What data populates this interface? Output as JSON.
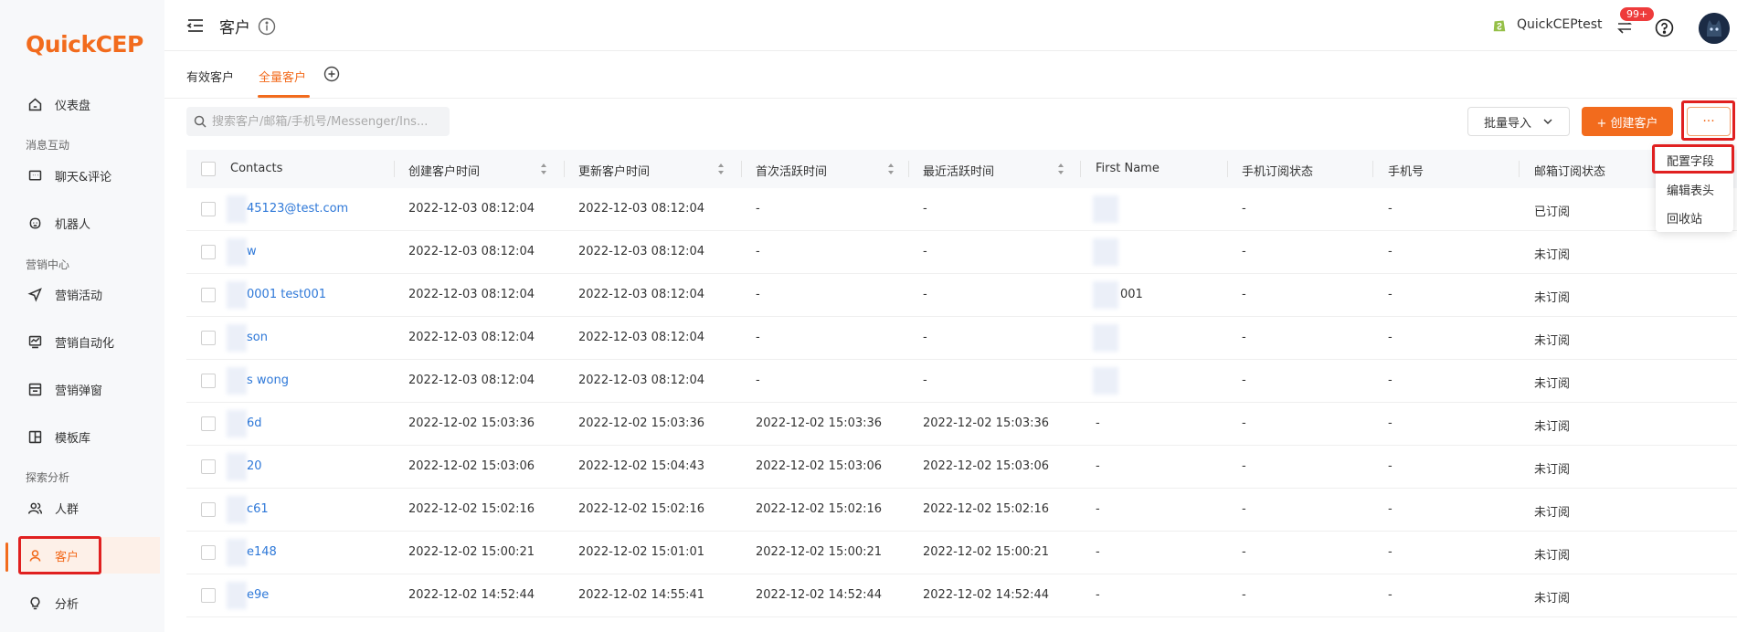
{
  "app": {
    "logo": {
      "q": "Q",
      "rest": "uick",
      "cep": "CEP"
    }
  },
  "colors": {
    "accent": "#f26b1d",
    "link": "#2e78d8",
    "alert": "#e02020"
  },
  "sidebar": {
    "items": [
      {
        "label": "仪表盘",
        "icon": "home-icon"
      },
      {
        "section": "消息互动"
      },
      {
        "label": "聊天&评论",
        "icon": "chat-icon"
      },
      {
        "label": "机器人",
        "icon": "robot-icon"
      },
      {
        "section": "营销中心"
      },
      {
        "label": "营销活动",
        "icon": "send-icon"
      },
      {
        "label": "营销自动化",
        "icon": "automation-icon"
      },
      {
        "label": "营销弹窗",
        "icon": "popup-icon"
      },
      {
        "label": "模板库",
        "icon": "template-icon"
      },
      {
        "section": "探索分析"
      },
      {
        "label": "人群",
        "icon": "people-icon"
      },
      {
        "label": "客户",
        "icon": "user-icon",
        "active": true
      },
      {
        "label": "分析",
        "icon": "bulb-icon"
      }
    ],
    "labels": {
      "dashboard": "仪表盘",
      "section_message": "消息互动",
      "chat": "聊天&评论",
      "robot": "机器人",
      "section_marketing": "营销中心",
      "campaign": "营销活动",
      "automation": "营销自动化",
      "popup": "营销弹窗",
      "template": "模板库",
      "section_explore": "探索分析",
      "audience": "人群",
      "customers": "客户",
      "analysis": "分析"
    }
  },
  "header": {
    "title": "客户",
    "shop_name": "QuickCEPtest",
    "notification_badge": "99+"
  },
  "tabs": {
    "valid": "有效客户",
    "all": "全量客户"
  },
  "toolbar": {
    "search_placeholder": "搜索客户/邮箱/手机号/Messenger/Ins...",
    "import_label": "批量导入",
    "create_label": "+ 创建客户",
    "more_label": "···"
  },
  "dropdown": {
    "items": [
      "配置字段",
      "编辑表头",
      "回收站"
    ]
  },
  "table": {
    "columns": [
      "Contacts",
      "创建客户时间",
      "更新客户时间",
      "首次活跃时间",
      "最近活跃时间",
      "First Name",
      "手机订阅状态",
      "手机号",
      "邮箱订阅状态"
    ],
    "rows": [
      {
        "contact": "45123@test.com",
        "created": "2022-12-03 08:12:04",
        "updated": "2022-12-03 08:12:04",
        "first_active": "-",
        "last_active": "-",
        "first_name": "",
        "sms_status": "-",
        "phone": "-",
        "email_status": "已订阅"
      },
      {
        "contact": "w",
        "created": "2022-12-03 08:12:04",
        "updated": "2022-12-03 08:12:04",
        "first_active": "-",
        "last_active": "-",
        "first_name": "",
        "sms_status": "-",
        "phone": "-",
        "email_status": "未订阅"
      },
      {
        "contact": "0001 test001",
        "created": "2022-12-03 08:12:04",
        "updated": "2022-12-03 08:12:04",
        "first_active": "-",
        "last_active": "-",
        "first_name": "001",
        "sms_status": "-",
        "phone": "-",
        "email_status": "未订阅"
      },
      {
        "contact": "son",
        "created": "2022-12-03 08:12:04",
        "updated": "2022-12-03 08:12:04",
        "first_active": "-",
        "last_active": "-",
        "first_name": "",
        "sms_status": "-",
        "phone": "-",
        "email_status": "未订阅"
      },
      {
        "contact": "s wong",
        "created": "2022-12-03 08:12:04",
        "updated": "2022-12-03 08:12:04",
        "first_active": "-",
        "last_active": "-",
        "first_name": "",
        "sms_status": "-",
        "phone": "-",
        "email_status": "未订阅"
      },
      {
        "contact": "6d",
        "created": "2022-12-02 15:03:36",
        "updated": "2022-12-02 15:03:36",
        "first_active": "2022-12-02 15:03:36",
        "last_active": "2022-12-02 15:03:36",
        "first_name": "-",
        "sms_status": "-",
        "phone": "-",
        "email_status": "未订阅"
      },
      {
        "contact": "20",
        "created": "2022-12-02 15:03:06",
        "updated": "2022-12-02 15:04:43",
        "first_active": "2022-12-02 15:03:06",
        "last_active": "2022-12-02 15:03:06",
        "first_name": "-",
        "sms_status": "-",
        "phone": "-",
        "email_status": "未订阅"
      },
      {
        "contact": "c61",
        "created": "2022-12-02 15:02:16",
        "updated": "2022-12-02 15:02:16",
        "first_active": "2022-12-02 15:02:16",
        "last_active": "2022-12-02 15:02:16",
        "first_name": "-",
        "sms_status": "-",
        "phone": "-",
        "email_status": "未订阅"
      },
      {
        "contact": "e148",
        "created": "2022-12-02 15:00:21",
        "updated": "2022-12-02 15:01:01",
        "first_active": "2022-12-02 15:00:21",
        "last_active": "2022-12-02 15:00:21",
        "first_name": "-",
        "sms_status": "-",
        "phone": "-",
        "email_status": "未订阅"
      },
      {
        "contact": "e9e",
        "created": "2022-12-02 14:52:44",
        "updated": "2022-12-02 14:55:41",
        "first_active": "2022-12-02 14:52:44",
        "last_active": "2022-12-02 14:52:44",
        "first_name": "-",
        "sms_status": "-",
        "phone": "-",
        "email_status": "未订阅"
      }
    ]
  }
}
